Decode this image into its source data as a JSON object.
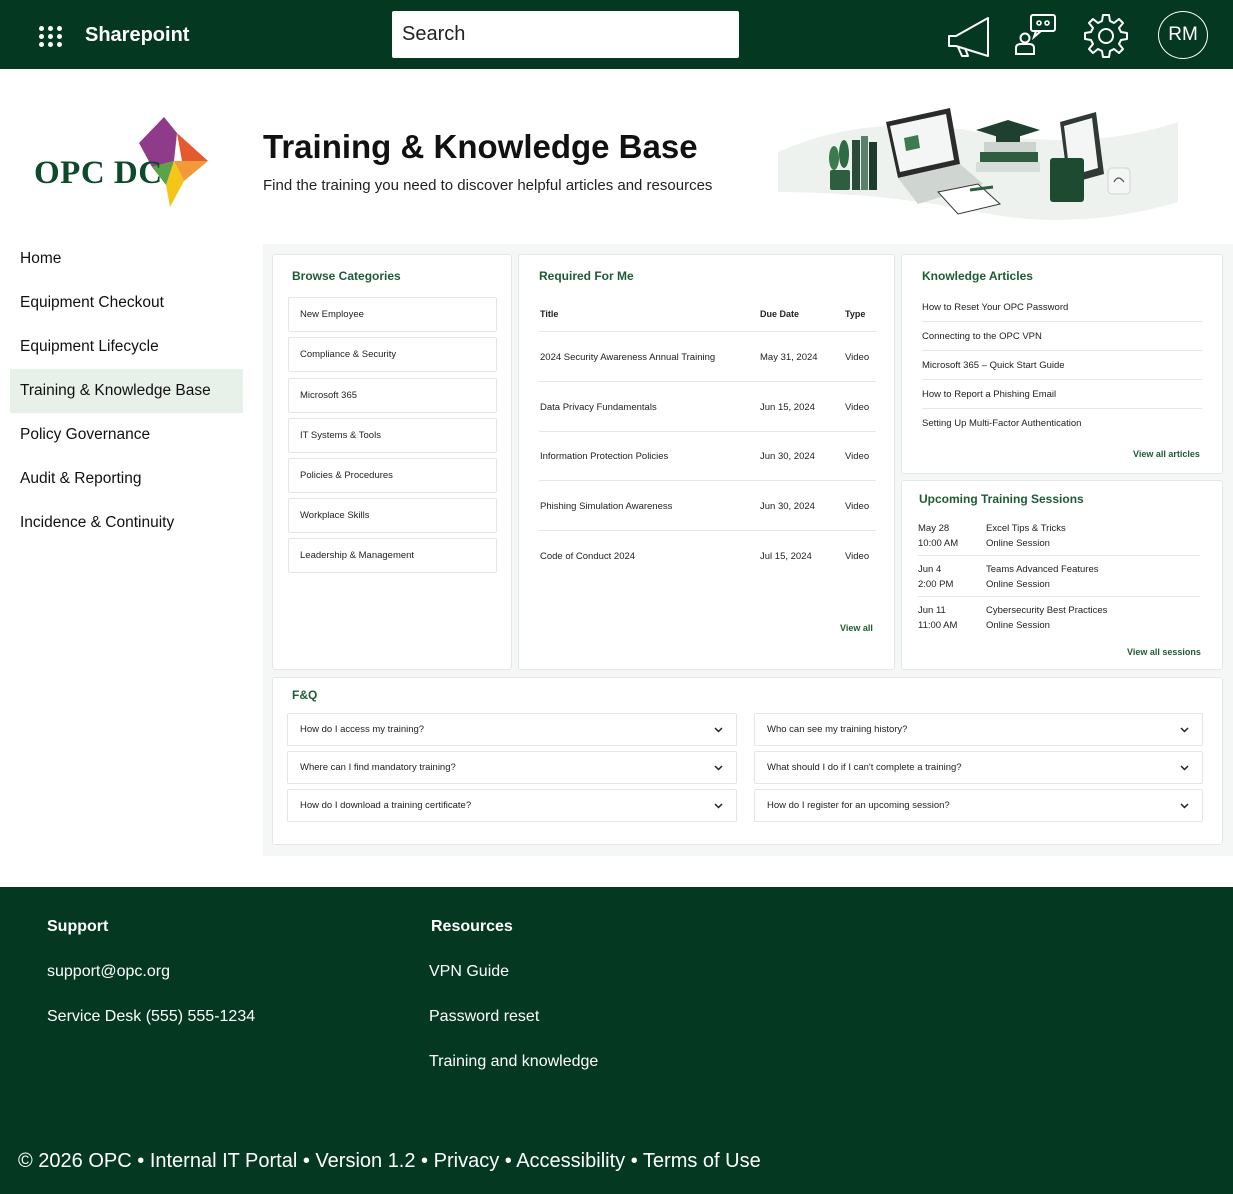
{
  "topbar": {
    "brand": "Sharepoint",
    "search_placeholder": "Search",
    "avatar_initials": "RM"
  },
  "logo": {
    "text": "OPC DC"
  },
  "header": {
    "title": "Training & Knowledge Base",
    "subtitle": "Find the training you need to discover helpful articles and resources"
  },
  "sidebar": {
    "items": [
      {
        "label": "Home"
      },
      {
        "label": "Equipment Checkout"
      },
      {
        "label": "Equipment Lifecycle"
      },
      {
        "label": "Training & Knowledge Base",
        "active": true
      },
      {
        "label": "Policy Governance"
      },
      {
        "label": "Audit & Reporting"
      },
      {
        "label": "Incidence & Continuity"
      }
    ]
  },
  "browse": {
    "title": "Browse Categories",
    "items": [
      "New Employee",
      "Compliance & Security",
      "Microsoft 365",
      "IT Systems & Tools",
      "Policies & Procedures",
      "Workplace Skills",
      "Leadership & Management"
    ]
  },
  "required": {
    "title": "Required For Me",
    "columns": [
      "Title",
      "Due Date",
      "Type"
    ],
    "rows": [
      {
        "title": "2024 Security Awareness Annual Training",
        "due": "May 31, 2024",
        "type": "Video"
      },
      {
        "title": "Data Privacy Fundamentals",
        "due": "Jun 15, 2024",
        "type": "Video"
      },
      {
        "title": "Information Protection Policies",
        "due": "Jun 30, 2024",
        "type": "Video"
      },
      {
        "title": "Phishing Simulation Awareness",
        "due": "Jun 30, 2024",
        "type": "Video"
      },
      {
        "title": "Code of Conduct 2024",
        "due": "Jul 15, 2024",
        "type": "Video"
      }
    ],
    "view_all": "View all"
  },
  "articles": {
    "title": "Knowledge Articles",
    "items": [
      "How to Reset Your OPC Password",
      "Connecting to the OPC VPN",
      "Microsoft 365 – Quick Start Guide",
      "How to Report a Phishing Email",
      "Setting Up Multi-Factor Authentication"
    ],
    "view_all": "View all articles"
  },
  "sessions": {
    "title": "Upcoming Training Sessions",
    "items": [
      {
        "date": "May 28",
        "time": "10:00 AM",
        "name": "Excel Tips & Tricks",
        "mode": "Online Session"
      },
      {
        "date": "Jun 4",
        "time": "2:00 PM",
        "name": "Teams Advanced Features",
        "mode": "Online Session"
      },
      {
        "date": "Jun 11",
        "time": "11:00 AM",
        "name": "Cybersecurity Best Practices",
        "mode": "Online Session"
      }
    ],
    "view_all": "View all sessions"
  },
  "faq": {
    "title": "F&Q",
    "left": [
      "How do I access my training?",
      "Where can I find mandatory training?",
      "How do I download a training certificate?"
    ],
    "right": [
      "Who can see my training history?",
      "What should I do if I can't complete a training?",
      "How do I register for an upcoming session?"
    ]
  },
  "footer": {
    "support": {
      "heading": "Support",
      "links": [
        "support@opc.org",
        "Service Desk (555) 555-1234"
      ]
    },
    "resources": {
      "heading": "Resources",
      "links": [
        "VPN Guide",
        "Password reset",
        "Training and knowledge"
      ]
    },
    "bottom": [
      "© 2026 OPC",
      "Internal IT Portal",
      "Version 1.2",
      "Privacy",
      "Accessibility",
      "Terms of Use"
    ],
    "separator": " • "
  },
  "colors": {
    "brand_green": "#053821",
    "accent_green": "#1f5b36",
    "active_nav": "#e8f0ea"
  },
  "icons": [
    "waffle-icon",
    "megaphone-icon",
    "feedback-icon",
    "gear-icon",
    "chevron-down-icon"
  ]
}
